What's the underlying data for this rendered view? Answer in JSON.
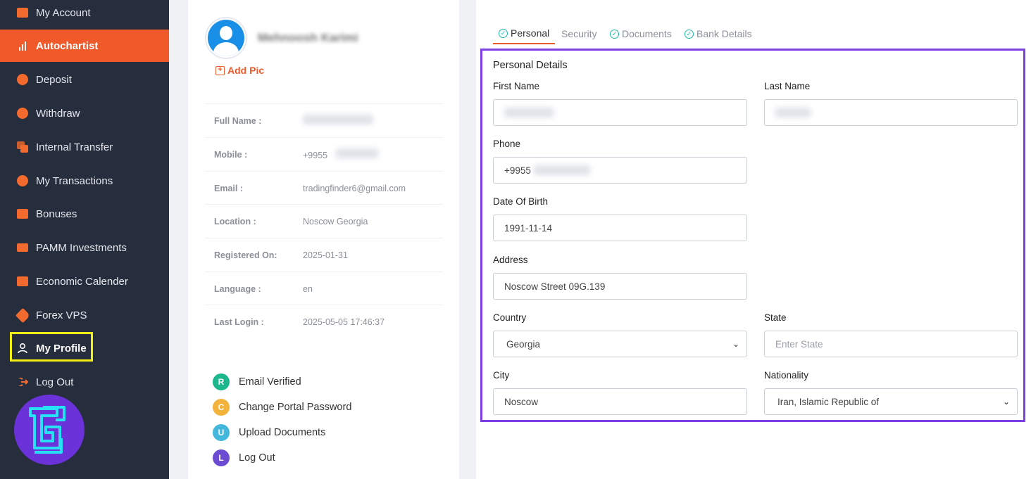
{
  "sidebar": {
    "items": [
      {
        "label": "My Account"
      },
      {
        "label": "Autochartist"
      },
      {
        "label": "Deposit"
      },
      {
        "label": "Withdraw"
      },
      {
        "label": "Internal Transfer"
      },
      {
        "label": "My Transactions"
      },
      {
        "label": "Bonuses"
      },
      {
        "label": "PAMM Investments"
      },
      {
        "label": "Economic Calender"
      },
      {
        "label": "Forex VPS"
      },
      {
        "label": "My Profile"
      },
      {
        "label": "Log Out"
      }
    ]
  },
  "profile": {
    "name": "Mehnoosh Karimi",
    "add_pic": "Add Pic",
    "rows": [
      {
        "label": "Full Name :",
        "value": ""
      },
      {
        "label": "Mobile :",
        "value": "+9955"
      },
      {
        "label": "Email :",
        "value": "tradingfinder6@gmail.com"
      },
      {
        "label": "Location :",
        "value": "Noscow Georgia"
      },
      {
        "label": "Registered On:",
        "value": "2025-01-31"
      },
      {
        "label": "Language :",
        "value": "en"
      },
      {
        "label": "Last Login :",
        "value": "2025-05-05 17:46:37"
      }
    ],
    "actions": [
      {
        "letter": "R",
        "label": "Email Verified",
        "color": "#1cb78d"
      },
      {
        "letter": "C",
        "label": "Change Portal Password",
        "color": "#f3b23c"
      },
      {
        "letter": "U",
        "label": "Upload Documents",
        "color": "#44b8dc"
      },
      {
        "letter": "L",
        "label": "Log Out",
        "color": "#6c4bd3"
      }
    ]
  },
  "tabs": [
    {
      "label": "Personal"
    },
    {
      "label": "Security"
    },
    {
      "label": "Documents"
    },
    {
      "label": "Bank Details"
    }
  ],
  "form": {
    "title": "Personal Details",
    "first_name_label": "First Name",
    "last_name_label": "Last Name",
    "phone_label": "Phone",
    "phone_value": "+9955",
    "dob_label": "Date Of Birth",
    "dob_value": "1991-11-14",
    "address_label": "Address",
    "address_value": "Noscow Street 09G.139",
    "country_label": "Country",
    "country_value": "Georgia",
    "state_label": "State",
    "state_placeholder": "Enter State",
    "city_label": "City",
    "city_value": "Noscow",
    "nationality_label": "Nationality",
    "nationality_value": "Iran, Islamic Republic of"
  },
  "colors": {
    "accent": "#f0592a",
    "sidebar_bg": "#262d3d",
    "highlight": "#7d3ee3",
    "profile_highlight": "#f3ee16"
  }
}
